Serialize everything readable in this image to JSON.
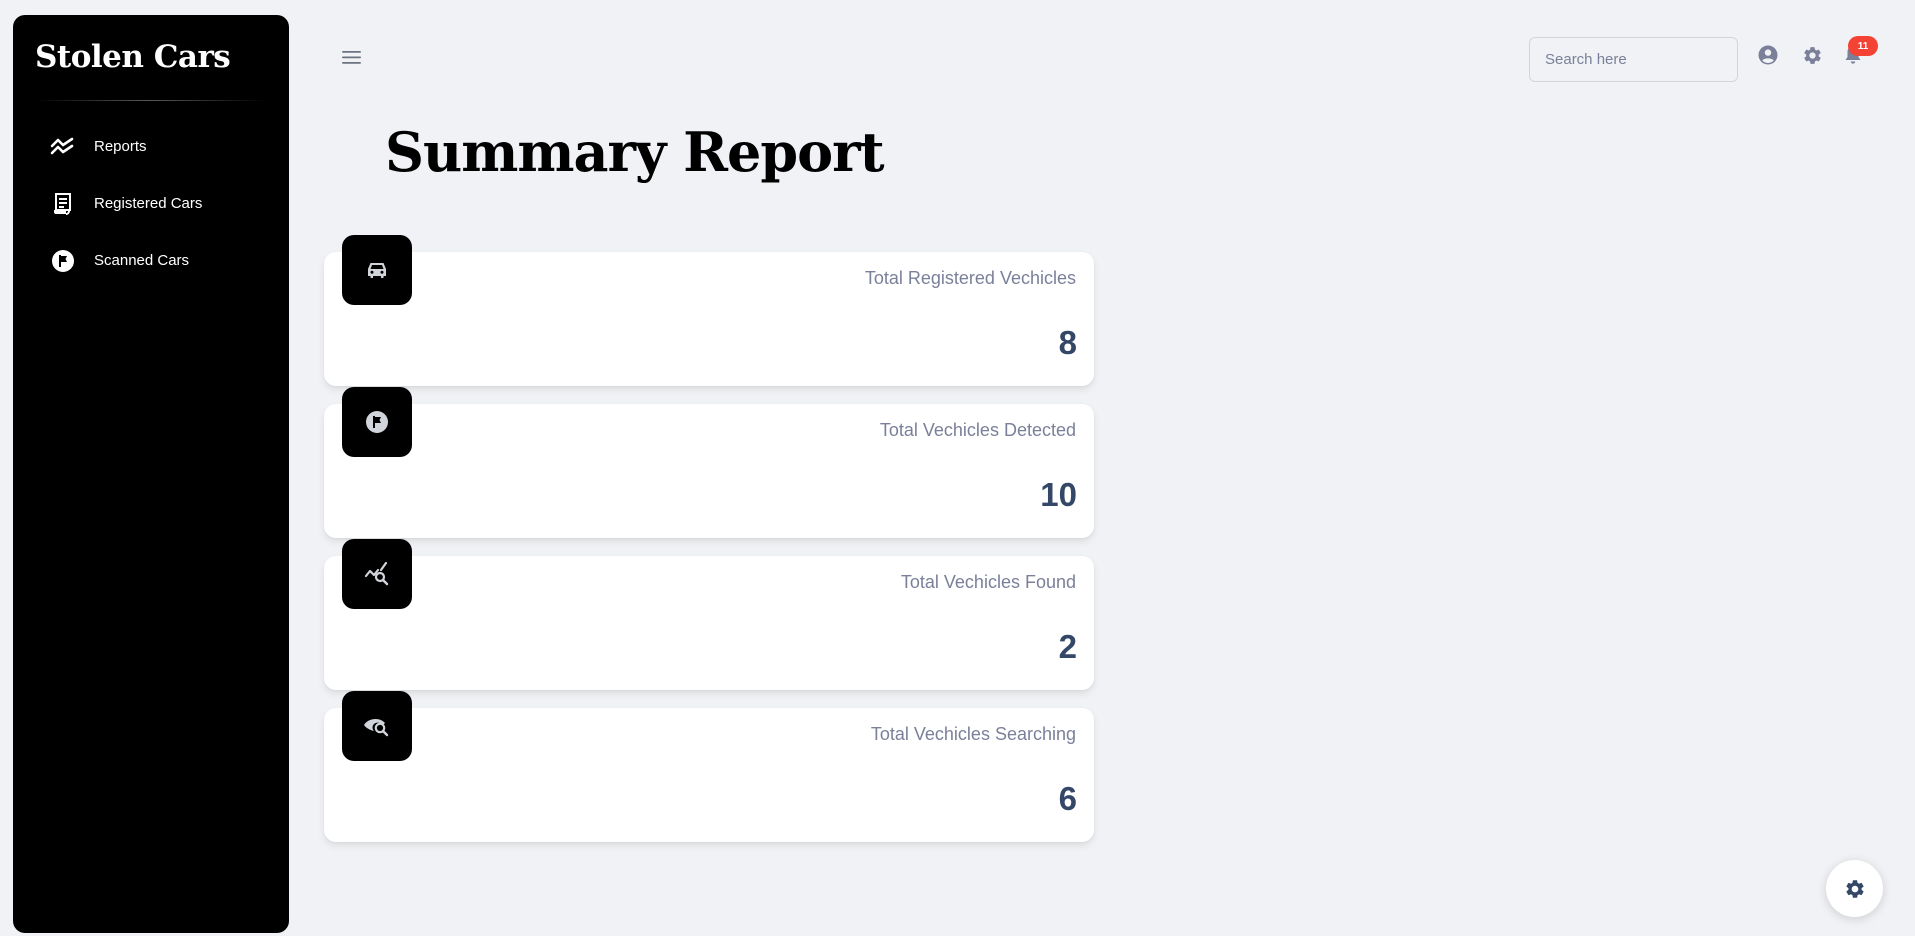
{
  "app": {
    "brand": "Stolen Cars"
  },
  "sidebar": {
    "items": [
      {
        "label": "Reports",
        "icon": "trending-icon"
      },
      {
        "label": "Registered Cars",
        "icon": "receipt-icon"
      },
      {
        "label": "Scanned Cars",
        "icon": "flag-icon"
      }
    ]
  },
  "topbar": {
    "search_placeholder": "Search here",
    "notification_count": "11"
  },
  "page": {
    "title": "Summary Report"
  },
  "stats": [
    {
      "label": "Total Registered Vechicles",
      "value": "8",
      "icon": "car-icon"
    },
    {
      "label": "Total Vechicles Detected",
      "value": "10",
      "icon": "flag-icon"
    },
    {
      "label": "Total Vechicles Found",
      "value": "2",
      "icon": "query-stats-icon"
    },
    {
      "label": "Total Vechicles Searching",
      "value": "6",
      "icon": "eye-search-icon"
    }
  ],
  "colors": {
    "background": "#f0f2f5",
    "sidebar": "#000000",
    "badge": "#f44335",
    "value_text": "#344767",
    "label_text": "#7b809a"
  }
}
